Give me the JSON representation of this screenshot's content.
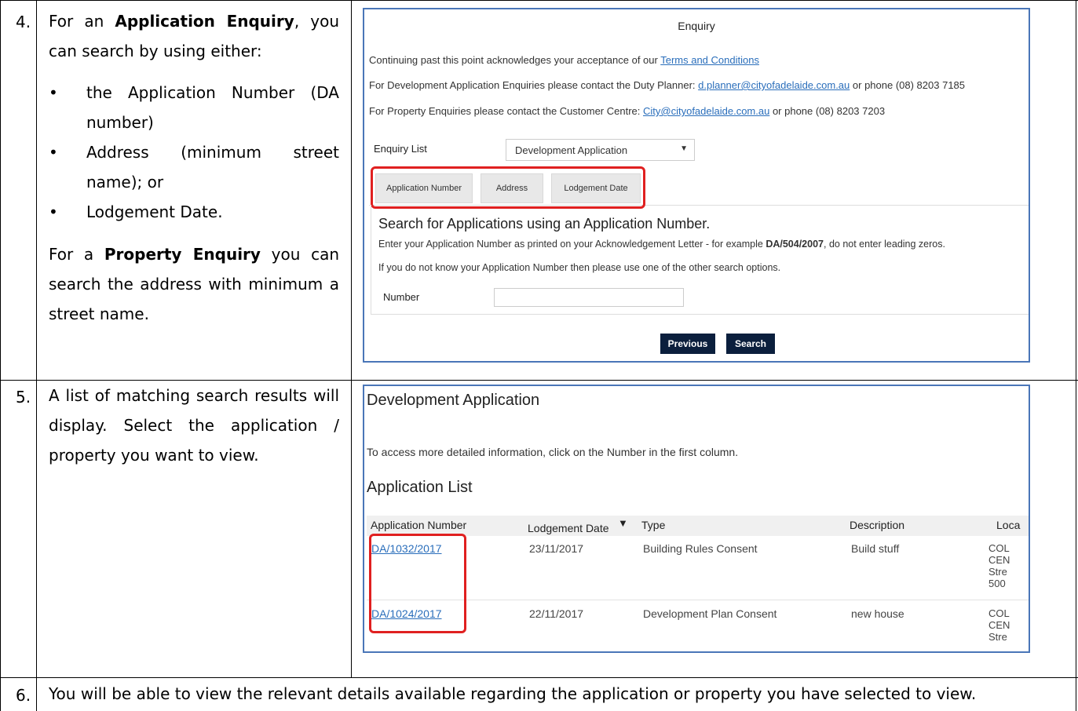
{
  "steps": [
    {
      "number": "4.",
      "intro_prefix": "For an ",
      "intro_bold": "Application Enquiry",
      "intro_suffix": ", you can search by using either:",
      "bullets": [
        "the Application Number (DA number)",
        "Address (minimum street name); or",
        "Lodgement Date."
      ],
      "property_prefix": "For a ",
      "property_bold": "Property Enquiry",
      "property_suffix": " you can search the address with minimum a street name."
    },
    {
      "number": "5.",
      "text": "A list of matching search results will display. Select the application / property you want to view."
    },
    {
      "number": "6.",
      "text": "You will be able to view the relevant details available regarding the application or property you have selected to view."
    }
  ],
  "enquiry_form": {
    "title": "Enquiry",
    "terms_prefix": "Continuing past this point acknowledges your acceptance of our ",
    "terms_link": "Terms and Conditions ",
    "dev_prefix": "For Development Application Enquiries please contact the Duty Planner: ",
    "dev_email": "d.planner@cityofadelaide.com.au",
    "dev_suffix": " or phone (08) 8203 7185",
    "prop_prefix": "For Property Enquiries please contact the Customer Centre: ",
    "prop_email": "City@cityofadelaide.com.au",
    "prop_suffix": " or phone (08) 8203 7203",
    "enquiry_list_label": "Enquiry List",
    "enquiry_list_value": "Development Application",
    "tabs": [
      "Application Number",
      "Address",
      "Lodgement Date"
    ],
    "search_heading": "Search for Applications using an Application Number.",
    "instruction_prefix": "Enter your Application Number as printed on your Acknowledgement Letter - for example ",
    "instruction_bold": "DA/504/2007",
    "instruction_suffix": ", do not enter leading zeros.",
    "help_text": "If you do not know your Application Number then please use one of the other search options.",
    "number_label": "Number",
    "number_value": "",
    "previous_button": "Previous",
    "search_button": "Search"
  },
  "results_page": {
    "title": "Development Application",
    "info_text": "To access more detailed information, click on the Number in the first column.",
    "list_title": "Application List",
    "columns": [
      "Application Number",
      "Lodgement Date",
      "Type",
      "Description",
      "Loca"
    ],
    "rows": [
      {
        "number": "DA/1032/2017",
        "date": "23/11/2017",
        "type": "Building Rules Consent",
        "description": "Build stuff",
        "location": [
          "COL",
          "CEN",
          "Stre",
          "500"
        ]
      },
      {
        "number": "DA/1024/2017",
        "date": "22/11/2017",
        "type": "Development Plan Consent",
        "description": "new house",
        "location": [
          "COL",
          "CEN",
          "Stre"
        ]
      }
    ]
  },
  "colors": {
    "highlight": "#e02020",
    "button": "#0b1f3d",
    "link": "#2a6ebb",
    "screenshot_border": "#4a76b8"
  }
}
